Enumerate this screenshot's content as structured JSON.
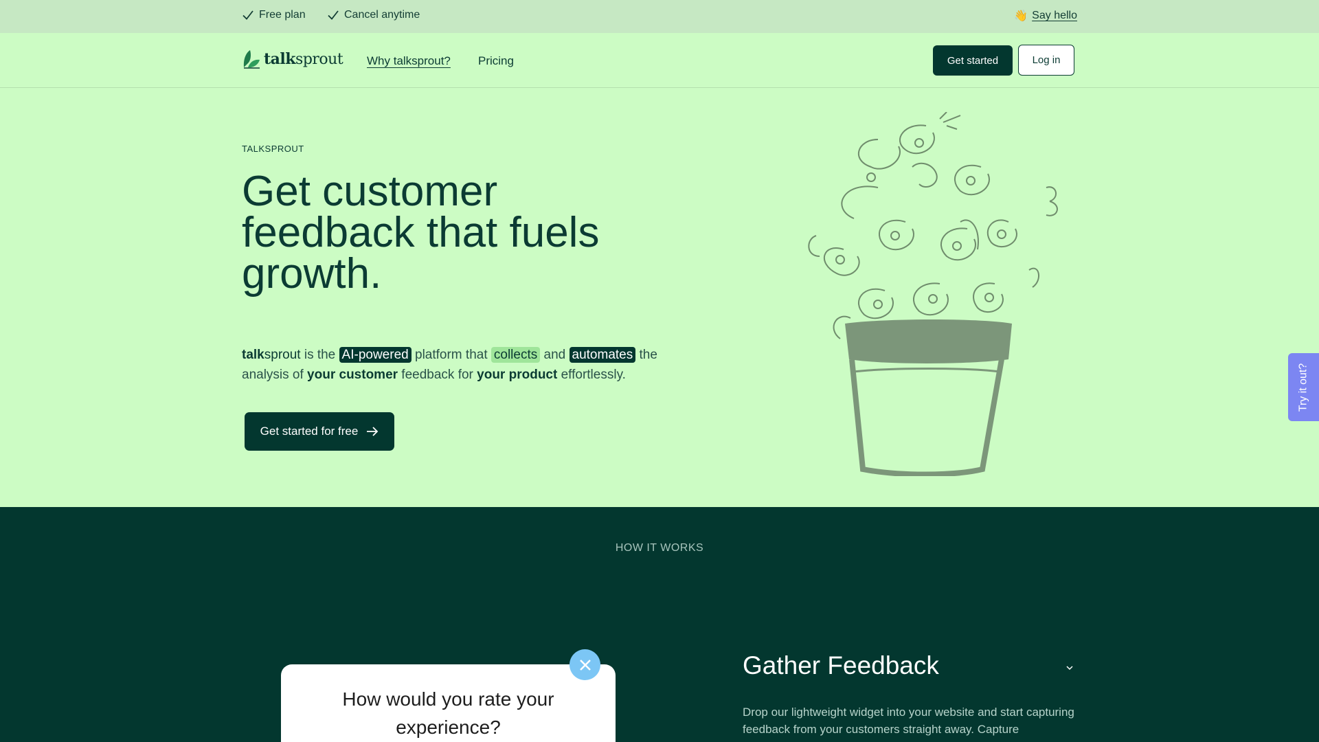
{
  "topbar": {
    "perks": [
      "Free plan",
      "Cancel anytime"
    ],
    "say_hello": "Say hello",
    "wave_icon": "waving-hand-icon"
  },
  "nav": {
    "logo_bold": "talk",
    "logo_rest": "sprout",
    "links": [
      "Why talksprout?",
      "Pricing"
    ],
    "get_started": "Get started",
    "log_in": "Log in"
  },
  "hero": {
    "eyebrow": "TALKSPROUT",
    "headline": "Get customer feedback that fuels growth.",
    "lede": {
      "brand_bold": "talk",
      "brand_rest": "sprout",
      "is_the": " is the ",
      "chip1": "AI-powered",
      "platform_that": " platform that ",
      "chip2": "collects",
      "and": " and ",
      "chip3": "automates",
      "the_analysis": " the analysis of ",
      "bold1": "your customer",
      "feedback_for": " feedback for ",
      "bold2": "your product",
      "end": " effortlessly."
    },
    "cta": "Get started for free"
  },
  "try_tab": "Try it out?",
  "how": {
    "label": "HOW IT WORKS",
    "card_question": "How would you rate your experience?",
    "gather_title": "Gather Feedback",
    "gather_body": "Drop our lightweight widget into your website and start capturing feedback from your customers straight away. Capture"
  },
  "colors": {
    "brand_dark": "#03372f",
    "hero_bg": "#ccfcc4",
    "topbar_bg": "#c6e8c3",
    "accent_light": "#9fe59a",
    "try_tab": "#7c86f2",
    "close_btn": "#7cc6f5"
  }
}
